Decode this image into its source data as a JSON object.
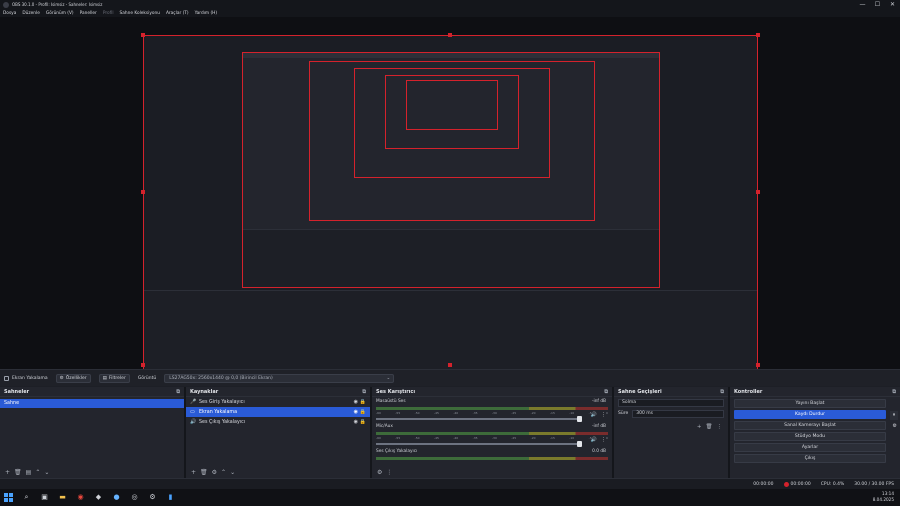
{
  "titlebar": {
    "title": "OBS 30.1.0 - Profil: Isimsiz - Sahneler: Isimsiz"
  },
  "window_controls": {
    "minimize": "—",
    "maximize": "☐",
    "close": "✕"
  },
  "menu": [
    "Dosya",
    "Düzenle",
    "Görünüm (V)",
    "Paneller",
    "Profil",
    "Sahne Koleksiyonu",
    "Araçlar (T)",
    "Yardım (H)"
  ],
  "toolbar": {
    "source_label": "Ekran Yakalama",
    "properties_label": "Özellikler",
    "filters_label": "Filtreler",
    "display_label": "Görüntü",
    "display_value": "LS27AG50x: 2560x1440 @ 0,0 (Birincil Ekran)"
  },
  "scenes": {
    "title": "Sahneler",
    "items": [
      "Sahne"
    ]
  },
  "sources": {
    "title": "Kaynaklar",
    "items": [
      {
        "icon": "🎤",
        "label": "Ses Giriş Yakalayıcı",
        "selected": false
      },
      {
        "icon": "▭",
        "label": "Ekran Yakalama",
        "selected": true
      },
      {
        "icon": "🔊",
        "label": "Ses Çıkış Yakalayıcı",
        "selected": false
      }
    ]
  },
  "mixer": {
    "title": "Ses Karıştırıcı",
    "ticks": [
      "-60",
      "-55",
      "-50",
      "-45",
      "-40",
      "-35",
      "-30",
      "-25",
      "-20",
      "-15",
      "-10",
      "-5",
      "0"
    ],
    "channels": [
      {
        "name": "Masaüstü Ses",
        "db": "-inf dB"
      },
      {
        "name": "Mic/Aux",
        "db": "-inf dB"
      },
      {
        "name": "Ses Çıkış Yakalayıcı",
        "db": "0.0 dB"
      }
    ]
  },
  "transitions": {
    "title": "Sahne Geçişleri",
    "type": "Solma",
    "duration_label": "Süre",
    "duration_value": "300 ms"
  },
  "controls": {
    "title": "Kontroller",
    "buttons": [
      "Yayını Başlat",
      "Kaydı Durdur",
      "Sanal Kamerayı Başlat",
      "Stüdyo Modu",
      "Ayarlar",
      "Çıkış"
    ],
    "active_index": 1
  },
  "status": {
    "frames": "00:00:00",
    "rec_time": "00:00:00",
    "cpu": "CPU: 0.4%",
    "fps": "30.00 / 30.00 FPS"
  },
  "taskbar": {
    "time": "13:14",
    "date": "8.04.2025",
    "icons": [
      "start-icon",
      "search-icon",
      "files-icon",
      "folder-icon",
      "chrome-icon",
      "app-icon",
      "steam-icon",
      "obs-icon",
      "settings-icon",
      "app2-icon"
    ]
  },
  "colors": {
    "accent": "#2a5bd7",
    "rec": "#d4222c",
    "panel": "#23252d"
  }
}
